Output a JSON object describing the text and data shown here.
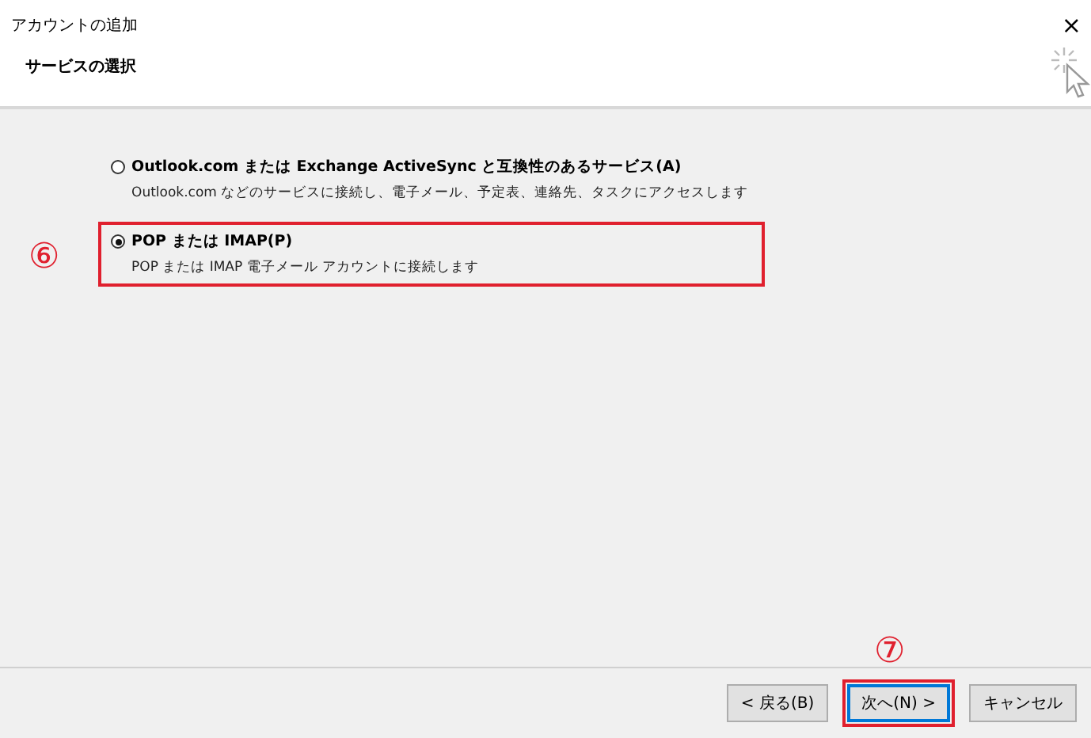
{
  "window": {
    "title": "アカウントの追加",
    "close": "×"
  },
  "header": {
    "title": "サービスの選択"
  },
  "options": [
    {
      "label": "Outlook.com または Exchange ActiveSync と互換性のあるサービス(A)",
      "description": "Outlook.com などのサービスに接続し、電子メール、予定表、連絡先、タスクにアクセスします",
      "selected": false,
      "highlighted": false
    },
    {
      "label": "POP または IMAP(P)",
      "description": "POP または IMAP 電子メール アカウントに接続します",
      "selected": true,
      "highlighted": true,
      "annotation": "⑥"
    }
  ],
  "buttons": [
    {
      "label": "< 戻る(B)",
      "default": false,
      "highlighted": false
    },
    {
      "label": "次へ(N) >",
      "default": true,
      "highlighted": true,
      "annotation": "⑦"
    },
    {
      "label": "キャンセル",
      "default": false,
      "highlighted": false
    }
  ]
}
